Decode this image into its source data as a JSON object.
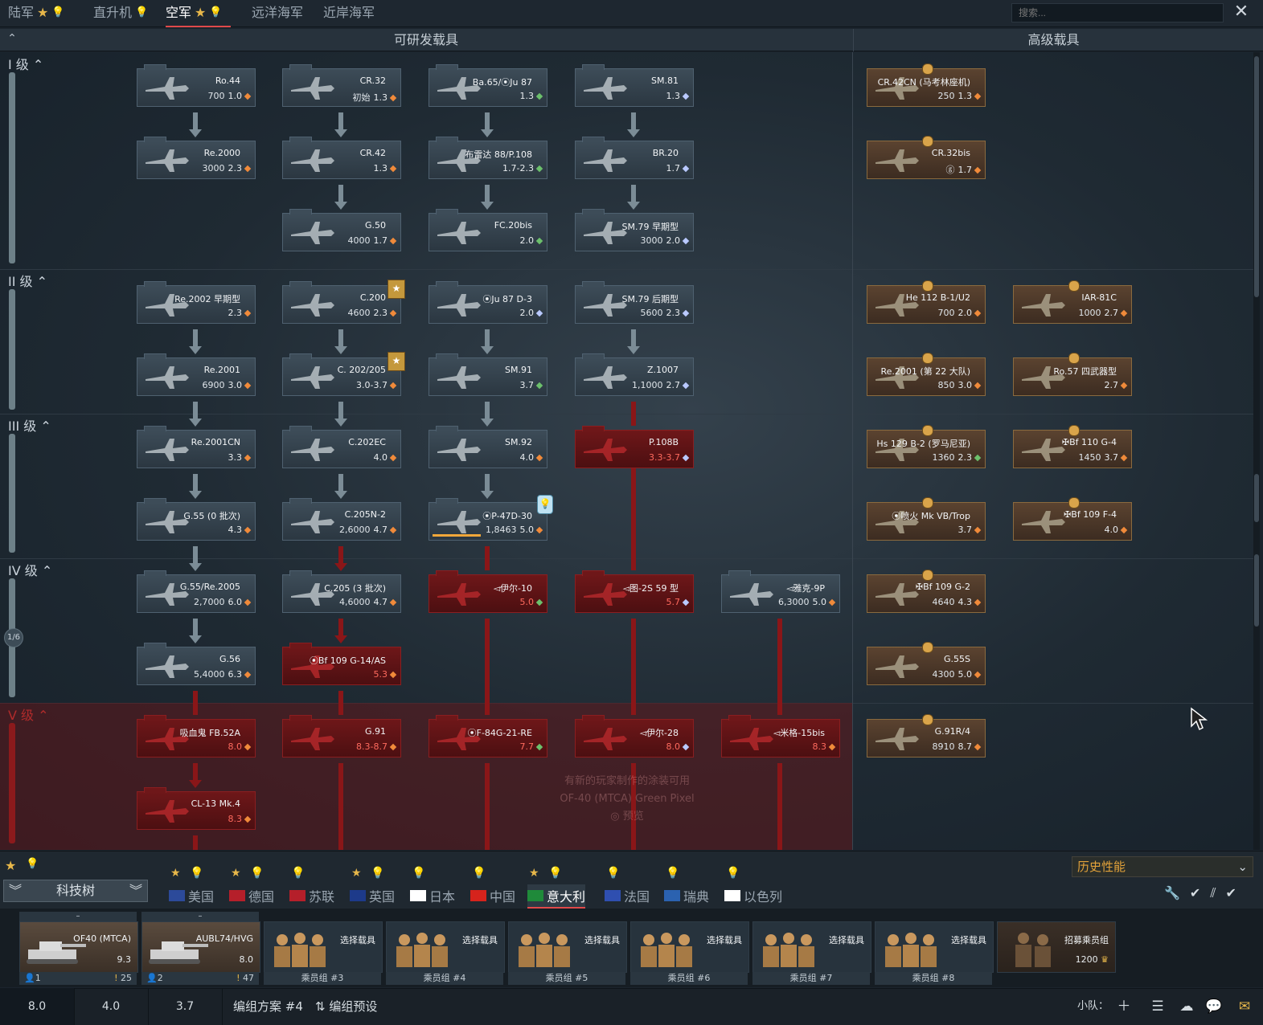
{
  "top_tabs": [
    {
      "label": "陆军"
    },
    {
      "label": "直升机"
    },
    {
      "label": "空军"
    },
    {
      "label": "远洋海军"
    },
    {
      "label": "近岸海军"
    }
  ],
  "search": {
    "placeholder": "搜索..."
  },
  "header": {
    "researchable": "可研发载具",
    "premium": "高级载具"
  },
  "ranks": [
    {
      "label": "I 级"
    },
    {
      "label": "II 级"
    },
    {
      "label": "III 级"
    },
    {
      "label": "IV 级"
    },
    {
      "label": "V 级"
    }
  ],
  "page_counter": "1/6",
  "vehicles": {
    "ro44": {
      "name": "Ro.44",
      "rp": "700",
      "br": "1.0"
    },
    "cr32": {
      "name": "CR.32",
      "rp": "初始",
      "br": "1.3"
    },
    "ba65": {
      "name": "Ba.65/⦿Ju 87",
      "rp": "",
      "br": "1.3"
    },
    "sm81": {
      "name": "SM.81",
      "rp": "",
      "br": "1.3"
    },
    "re2000": {
      "name": "Re.2000",
      "rp": "3000",
      "br": "2.3"
    },
    "cr42": {
      "name": "CR.42",
      "rp": "",
      "br": "1.3"
    },
    "breda88": {
      "name": "布雷达 88/P.108",
      "rp": "",
      "br": "1.7-2.3"
    },
    "br20": {
      "name": "BR.20",
      "rp": "",
      "br": "1.7"
    },
    "g50": {
      "name": "G.50",
      "rp": "4000",
      "br": "1.7"
    },
    "fc20": {
      "name": "FC.20bis",
      "rp": "",
      "br": "2.0"
    },
    "sm79e": {
      "name": "SM.79 早期型",
      "rp": "3000",
      "br": "2.0"
    },
    "re2002": {
      "name": "Re.2002 早期型",
      "rp": "",
      "br": "2.3"
    },
    "c200": {
      "name": "C.200",
      "rp": "4600",
      "br": "2.3"
    },
    "ju87d3": {
      "name": "⦿Ju 87 D-3",
      "rp": "",
      "br": "2.0"
    },
    "sm79l": {
      "name": "SM.79 后期型",
      "rp": "5600",
      "br": "2.3"
    },
    "re2001": {
      "name": "Re.2001",
      "rp": "6900",
      "br": "3.0"
    },
    "c202": {
      "name": "C. 202/205",
      "rp": "",
      "br": "3.0-3.7"
    },
    "sm91": {
      "name": "SM.91",
      "rp": "",
      "br": "3.7"
    },
    "z1007": {
      "name": "Z.1007",
      "rp": "1,1000",
      "br": "2.7"
    },
    "re2001cn": {
      "name": "Re.2001CN",
      "rp": "",
      "br": "3.3"
    },
    "c202ec": {
      "name": "C.202EC",
      "rp": "",
      "br": "4.0"
    },
    "sm92": {
      "name": "SM.92",
      "rp": "",
      "br": "4.0"
    },
    "p108b": {
      "name": "P.108B",
      "rp": "",
      "br": "3.3-3.7"
    },
    "g55s0": {
      "name": "G.55 (0 批次)",
      "rp": "",
      "br": "4.3"
    },
    "c205n2": {
      "name": "C.205N-2",
      "rp": "2,6000",
      "br": "4.7"
    },
    "p47d": {
      "name": "⦿P-47D-30",
      "rp": "1,8463",
      "br": "5.0"
    },
    "g55re2005": {
      "name": "G.55/Re.2005",
      "rp": "2,7000",
      "br": "6.0"
    },
    "c205s3": {
      "name": "C.205 (3 批次)",
      "rp": "4,6000",
      "br": "4.7"
    },
    "il10": {
      "name": "◅伊尔-10",
      "rp": "",
      "br": "5.0"
    },
    "tu2s": {
      "name": "◅图-2S 59 型",
      "rp": "",
      "br": "5.7"
    },
    "yak9p": {
      "name": "◅雅克-9P",
      "rp": "6,3000",
      "br": "5.0"
    },
    "g56": {
      "name": "G.56",
      "rp": "5,4000",
      "br": "6.3"
    },
    "bf109g14": {
      "name": "⦿Bf 109 G-14/AS",
      "rp": "",
      "br": "5.3"
    },
    "vampire": {
      "name": "吸血鬼 FB.52A",
      "rp": "",
      "br": "8.0"
    },
    "g91": {
      "name": "G.91",
      "rp": "",
      "br": "8.3-8.7"
    },
    "f84g": {
      "name": "⦿F-84G-21-RE",
      "rp": "",
      "br": "7.7"
    },
    "il28": {
      "name": "◅伊尔-28",
      "rp": "",
      "br": "8.0"
    },
    "mig15": {
      "name": "◅米格-15bis",
      "rp": "",
      "br": "8.3"
    },
    "cl13": {
      "name": "CL-13 Mk.4",
      "rp": "",
      "br": "8.3"
    },
    "cr42cn": {
      "name": "CR.42CN (马考林座机)",
      "rp": "250",
      "br": "1.3"
    },
    "cr32bis": {
      "name": "CR.32bis",
      "rp": "ⓖ",
      "br": "1.7"
    },
    "he112": {
      "name": "He 112 B-1/U2",
      "rp": "700",
      "br": "2.0"
    },
    "iar81c": {
      "name": "IAR-81C",
      "rp": "1000",
      "br": "2.7"
    },
    "re2001_22": {
      "name": "Re.2001 (第 22 大队)",
      "rp": "850",
      "br": "3.0"
    },
    "ro57": {
      "name": "Ro.57 四武器型",
      "rp": "",
      "br": "2.7"
    },
    "hs129": {
      "name": "Hs 129 B-2 (罗马尼亚)",
      "rp": "1360",
      "br": "2.3"
    },
    "bf110": {
      "name": "✠Bf 110 G-4",
      "rp": "1450",
      "br": "3.7"
    },
    "spitfire": {
      "name": "⦿喷火 Mk VB/Trop",
      "rp": "",
      "br": "3.7"
    },
    "bf109f4": {
      "name": "✠Bf 109 F-4",
      "rp": "",
      "br": "4.0"
    },
    "bf109g2": {
      "name": "✠Bf 109 G-2",
      "rp": "4640",
      "br": "4.3"
    },
    "g55s": {
      "name": "G.55S",
      "rp": "4300",
      "br": "5.0"
    },
    "g91r4": {
      "name": "G.91R/4",
      "rp": "8910",
      "br": "8.7"
    }
  },
  "decal_note": {
    "line1": "有新的玩家制作的涂装可用",
    "line2": "OF-40 (MTCA) Green Pixel",
    "line3": "预览"
  },
  "history_select": "历史性能",
  "techtree_label": "科技树",
  "nations": [
    {
      "label": "美国"
    },
    {
      "label": "德国"
    },
    {
      "label": "苏联"
    },
    {
      "label": "英国"
    },
    {
      "label": "日本"
    },
    {
      "label": "中国"
    },
    {
      "label": "意大利"
    },
    {
      "label": "法国"
    },
    {
      "label": "瑞典"
    },
    {
      "label": "以色列"
    }
  ],
  "crew_slots": [
    {
      "name": "OF40 (MTCA)",
      "br": "9.3",
      "top": "–",
      "left": "1",
      "right": "25"
    },
    {
      "name": "AUBL74/HVG",
      "br": "8.0",
      "top": "–",
      "left": "2",
      "right": "47"
    },
    {
      "name": "选择载具",
      "caption": "乘员组 #3"
    },
    {
      "name": "选择载具",
      "caption": "乘员组 #4"
    },
    {
      "name": "选择载具",
      "caption": "乘员组 #5"
    },
    {
      "name": "选择载具",
      "caption": "乘员组 #6"
    },
    {
      "name": "选择载具",
      "caption": "乘员组 #7"
    },
    {
      "name": "选择载具",
      "caption": "乘员组 #8"
    },
    {
      "name": "招募乘员组",
      "cost": "1200"
    }
  ],
  "status": {
    "br_tabs": [
      "8.0",
      "4.0",
      "3.7"
    ],
    "preset": "编组方案 #4",
    "preset_btn": "编组预设",
    "squad": "小队："
  },
  "colors": {
    "accent_red": "#e0494a",
    "premium_gold": "#d9a44a",
    "locked_red": "#6e1719"
  }
}
